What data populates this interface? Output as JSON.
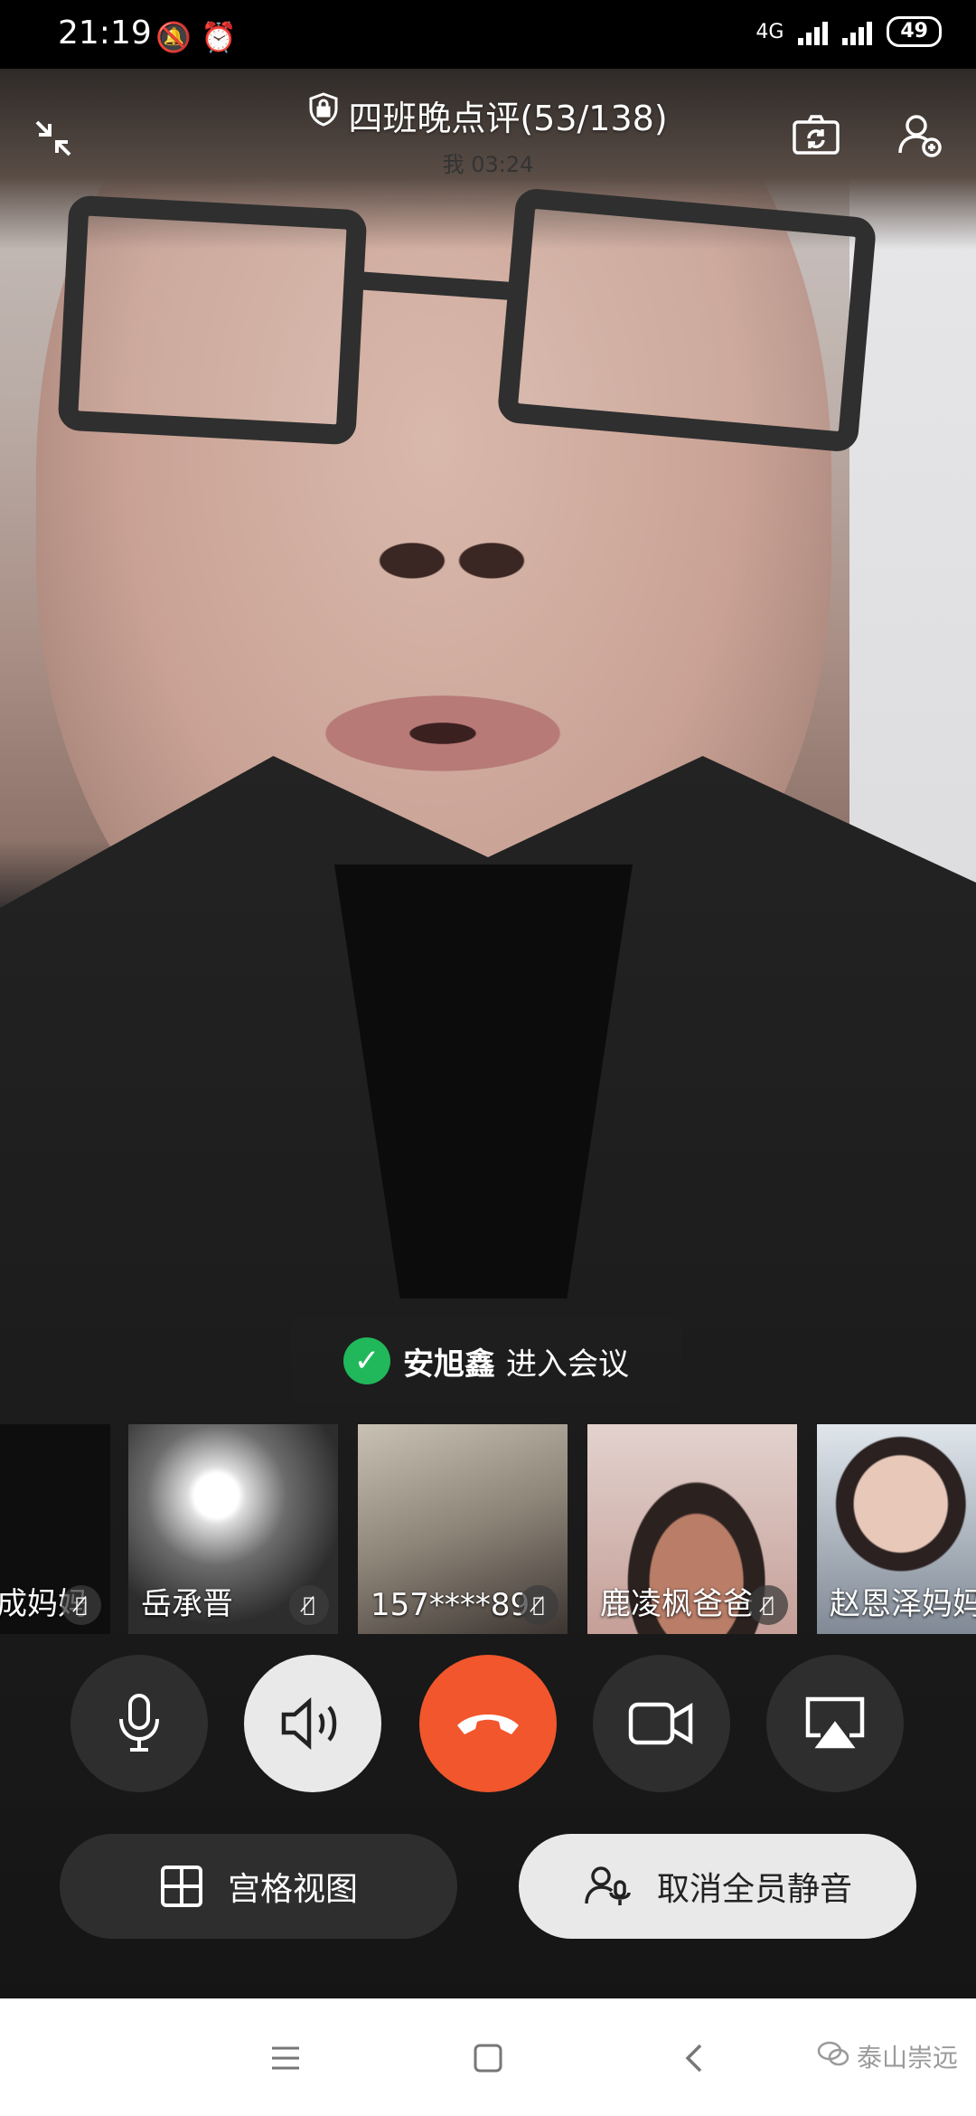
{
  "status_bar": {
    "time": "21:19",
    "network": "4G",
    "battery": "49"
  },
  "meeting": {
    "title": "四班晚点评(53/138)",
    "subtitle": "我 03:24"
  },
  "toast": {
    "name": "安旭鑫",
    "message": "进入会议"
  },
  "participants": [
    {
      "label": "成妈妈",
      "muted": true
    },
    {
      "label": "岳承晋",
      "muted": true
    },
    {
      "label": "157****89",
      "muted": true
    },
    {
      "label": "鹿凌枫爸爸",
      "muted": true
    },
    {
      "label": "赵恩泽妈妈",
      "muted": true
    }
  ],
  "controls": {
    "mic": "microphone-icon",
    "speaker": "speaker-icon",
    "hangup": "hangup-icon",
    "camera": "video-camera-icon",
    "share": "screen-share-icon"
  },
  "buttons": {
    "grid_view": "宫格视图",
    "unmute_all": "取消全员静音"
  },
  "watermark": "泰山崇远",
  "colors": {
    "hangup": "#f2562c",
    "success": "#20b85a",
    "dark_control": "#2e2e2e",
    "light_control": "#e9e9e9"
  }
}
